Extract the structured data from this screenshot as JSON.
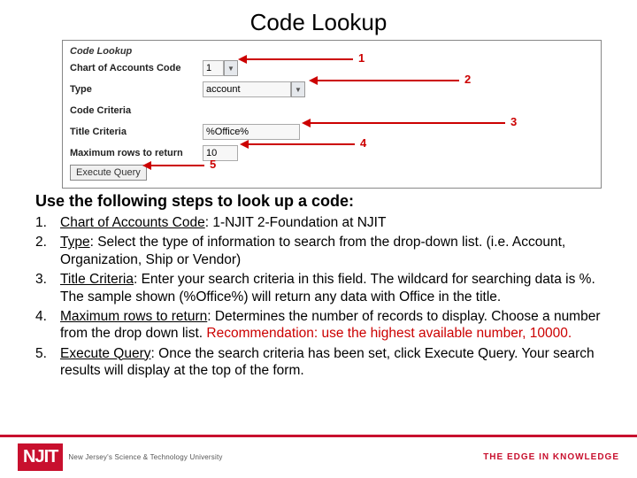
{
  "title": "Code Lookup",
  "form": {
    "heading": "Code Lookup",
    "rows": {
      "chart": {
        "label": "Chart of Accounts Code",
        "value": "1"
      },
      "type": {
        "label": "Type",
        "value": "account"
      },
      "criteria": {
        "label": "Code Criteria"
      },
      "title_criteria": {
        "label": "Title Criteria",
        "value": "%Office%"
      },
      "maxrows": {
        "label": "Maximum rows to return",
        "value": "10"
      }
    },
    "button": "Execute Query",
    "annotations": {
      "a1": "1",
      "a2": "2",
      "a3": "3",
      "a4": "4",
      "a5": "5"
    }
  },
  "steps_heading": "Use the following steps to look up a code:",
  "steps": [
    {
      "num": "1.",
      "label": "Chart of Accounts Code",
      "rest": ":  1-NJIT 2-Foundation at NJIT"
    },
    {
      "num": "2.",
      "label": "Type",
      "rest": ":  Select the type of information to search from the drop-down list. (i.e. Account, Organization, Ship or Vendor)"
    },
    {
      "num": "3.",
      "label": "Title Criteria",
      "rest": ":  Enter your search criteria in this field.  The wildcard for searching data is %.  The sample shown (%Office%) will return any data with Office in the title."
    },
    {
      "num": "4.",
      "label": "Maximum rows to return",
      "rest": ":  Determines the number of records to display.  Choose a number from the drop down list.  ",
      "rec": "Recommendation: use the highest available number, 10000."
    },
    {
      "num": "5.",
      "label": "Execute Query",
      "rest": ":  Once the search criteria has been set, click Execute Query.  Your search results will display at the top of the form."
    }
  ],
  "footer": {
    "logo_text": "NJIT",
    "logo_sub": "New Jersey's Science & Technology University",
    "tagline": "THE EDGE IN KNOWLEDGE"
  }
}
